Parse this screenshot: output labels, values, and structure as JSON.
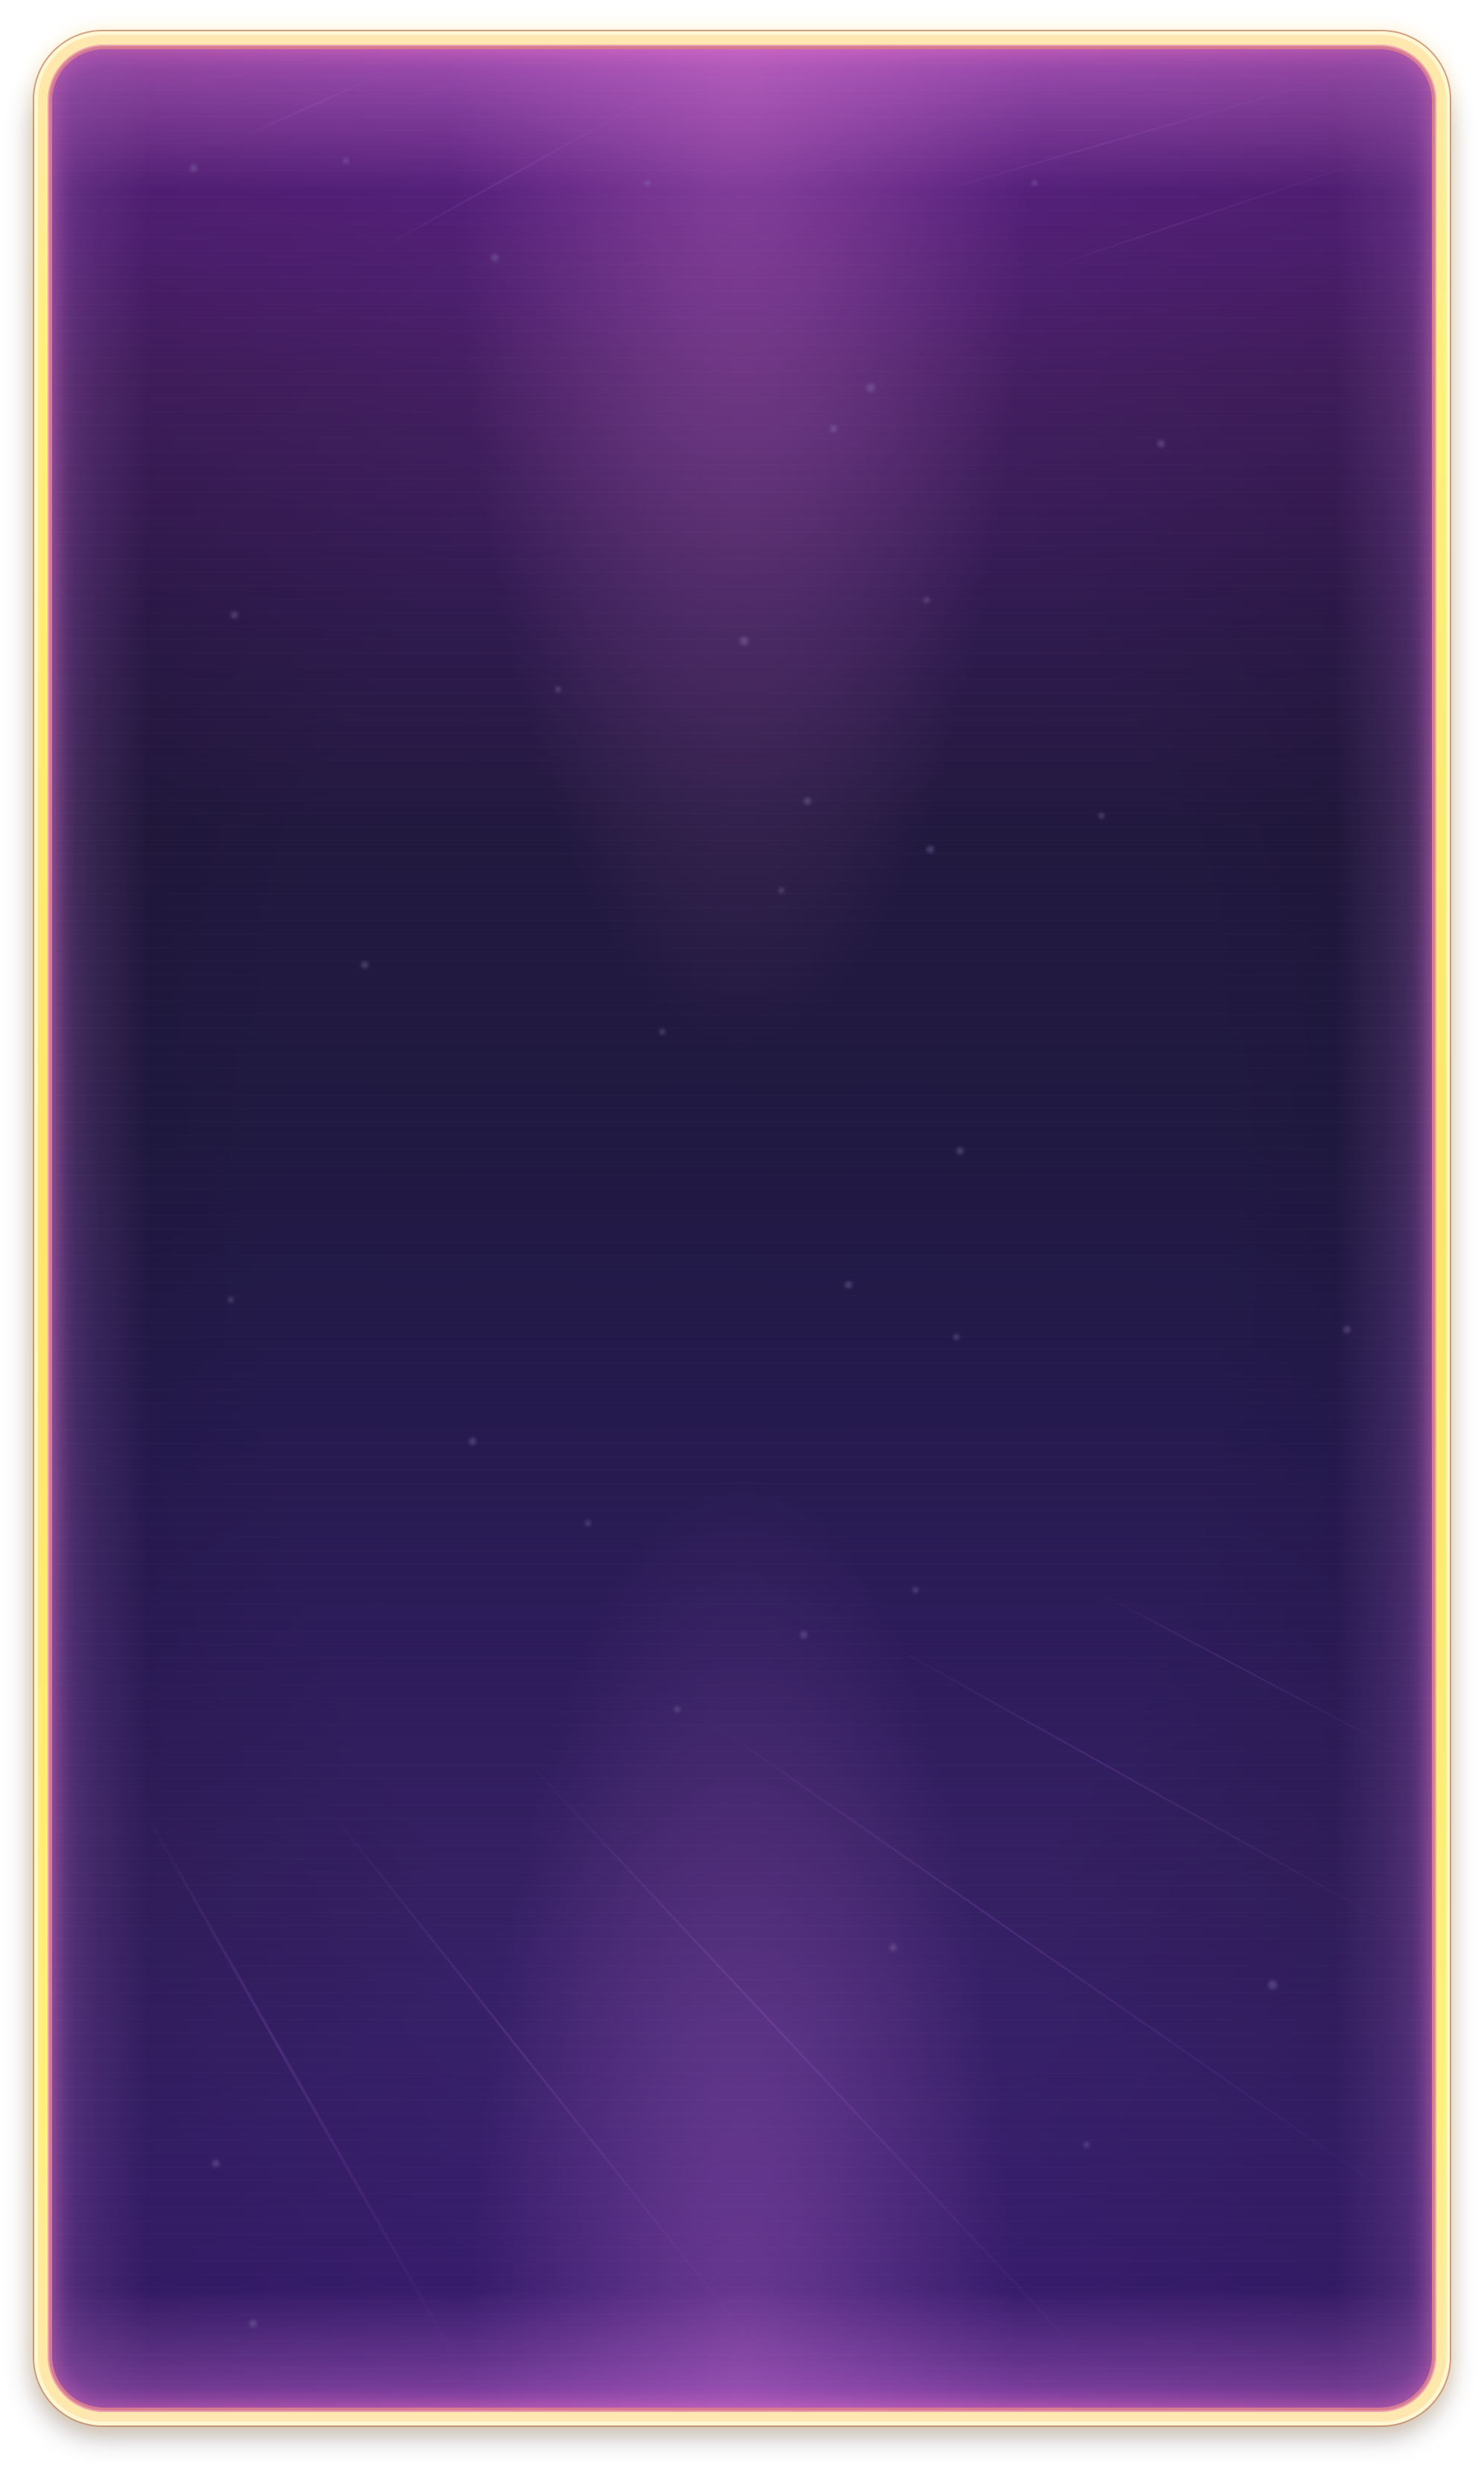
{
  "screen": {
    "name": "empty-card-panel",
    "state": "blank"
  },
  "colors": {
    "page_background": "#ffffff",
    "frame_gold": "#ffe56b",
    "frame_rose": "#d07b88",
    "panel_top": "#b45ac8",
    "panel_mid": "#201941",
    "panel_bottom": "#3c1f76",
    "glow_pink": "#ff7ad3",
    "star_color": "#8c7fb1",
    "line_color": "#a95bd8"
  },
  "decor": {
    "particles": "stars",
    "background_lines": "diagonal-light-rays",
    "frame_style": "rounded-gold-outline"
  }
}
